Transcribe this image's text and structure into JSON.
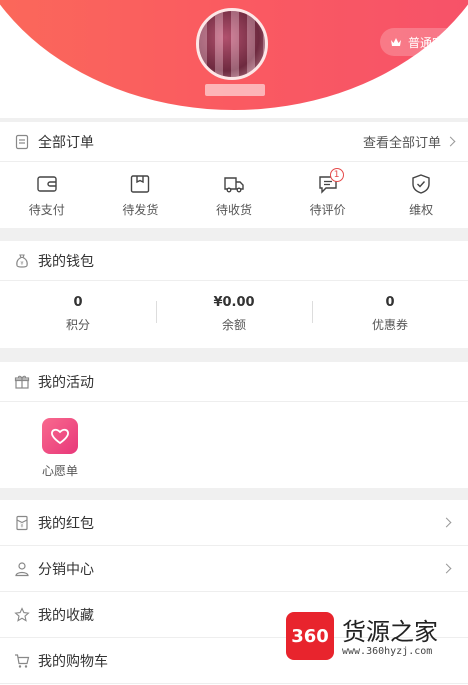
{
  "header": {
    "level_badge": "普通客户",
    "colors": {
      "gradient_start": "#fb6a59",
      "gradient_end": "#f6516a"
    }
  },
  "orders": {
    "title": "全部订单",
    "view_all": "查看全部订单",
    "items": [
      {
        "label": "待支付",
        "icon": "wallet-icon"
      },
      {
        "label": "待发货",
        "icon": "box-icon"
      },
      {
        "label": "待收货",
        "icon": "truck-icon"
      },
      {
        "label": "待评价",
        "icon": "comment-icon",
        "badge": "1"
      },
      {
        "label": "维权",
        "icon": "shield-icon"
      }
    ]
  },
  "wallet": {
    "title": "我的钱包",
    "stats": [
      {
        "value": "0",
        "label": "积分"
      },
      {
        "value": "¥0.00",
        "label": "余额"
      },
      {
        "value": "0",
        "label": "优惠券"
      }
    ]
  },
  "activity": {
    "title": "我的活动",
    "wish_label": "心愿单"
  },
  "menu": {
    "items": [
      {
        "label": "我的红包",
        "icon": "red-envelope-icon"
      },
      {
        "label": "分销中心",
        "icon": "user-icon"
      },
      {
        "label": "我的收藏",
        "icon": "star-icon"
      },
      {
        "label": "我的购物车",
        "icon": "cart-icon"
      }
    ]
  },
  "watermark": {
    "logo": "360",
    "name": "货源之家",
    "url": "www.360hyzj.com"
  }
}
